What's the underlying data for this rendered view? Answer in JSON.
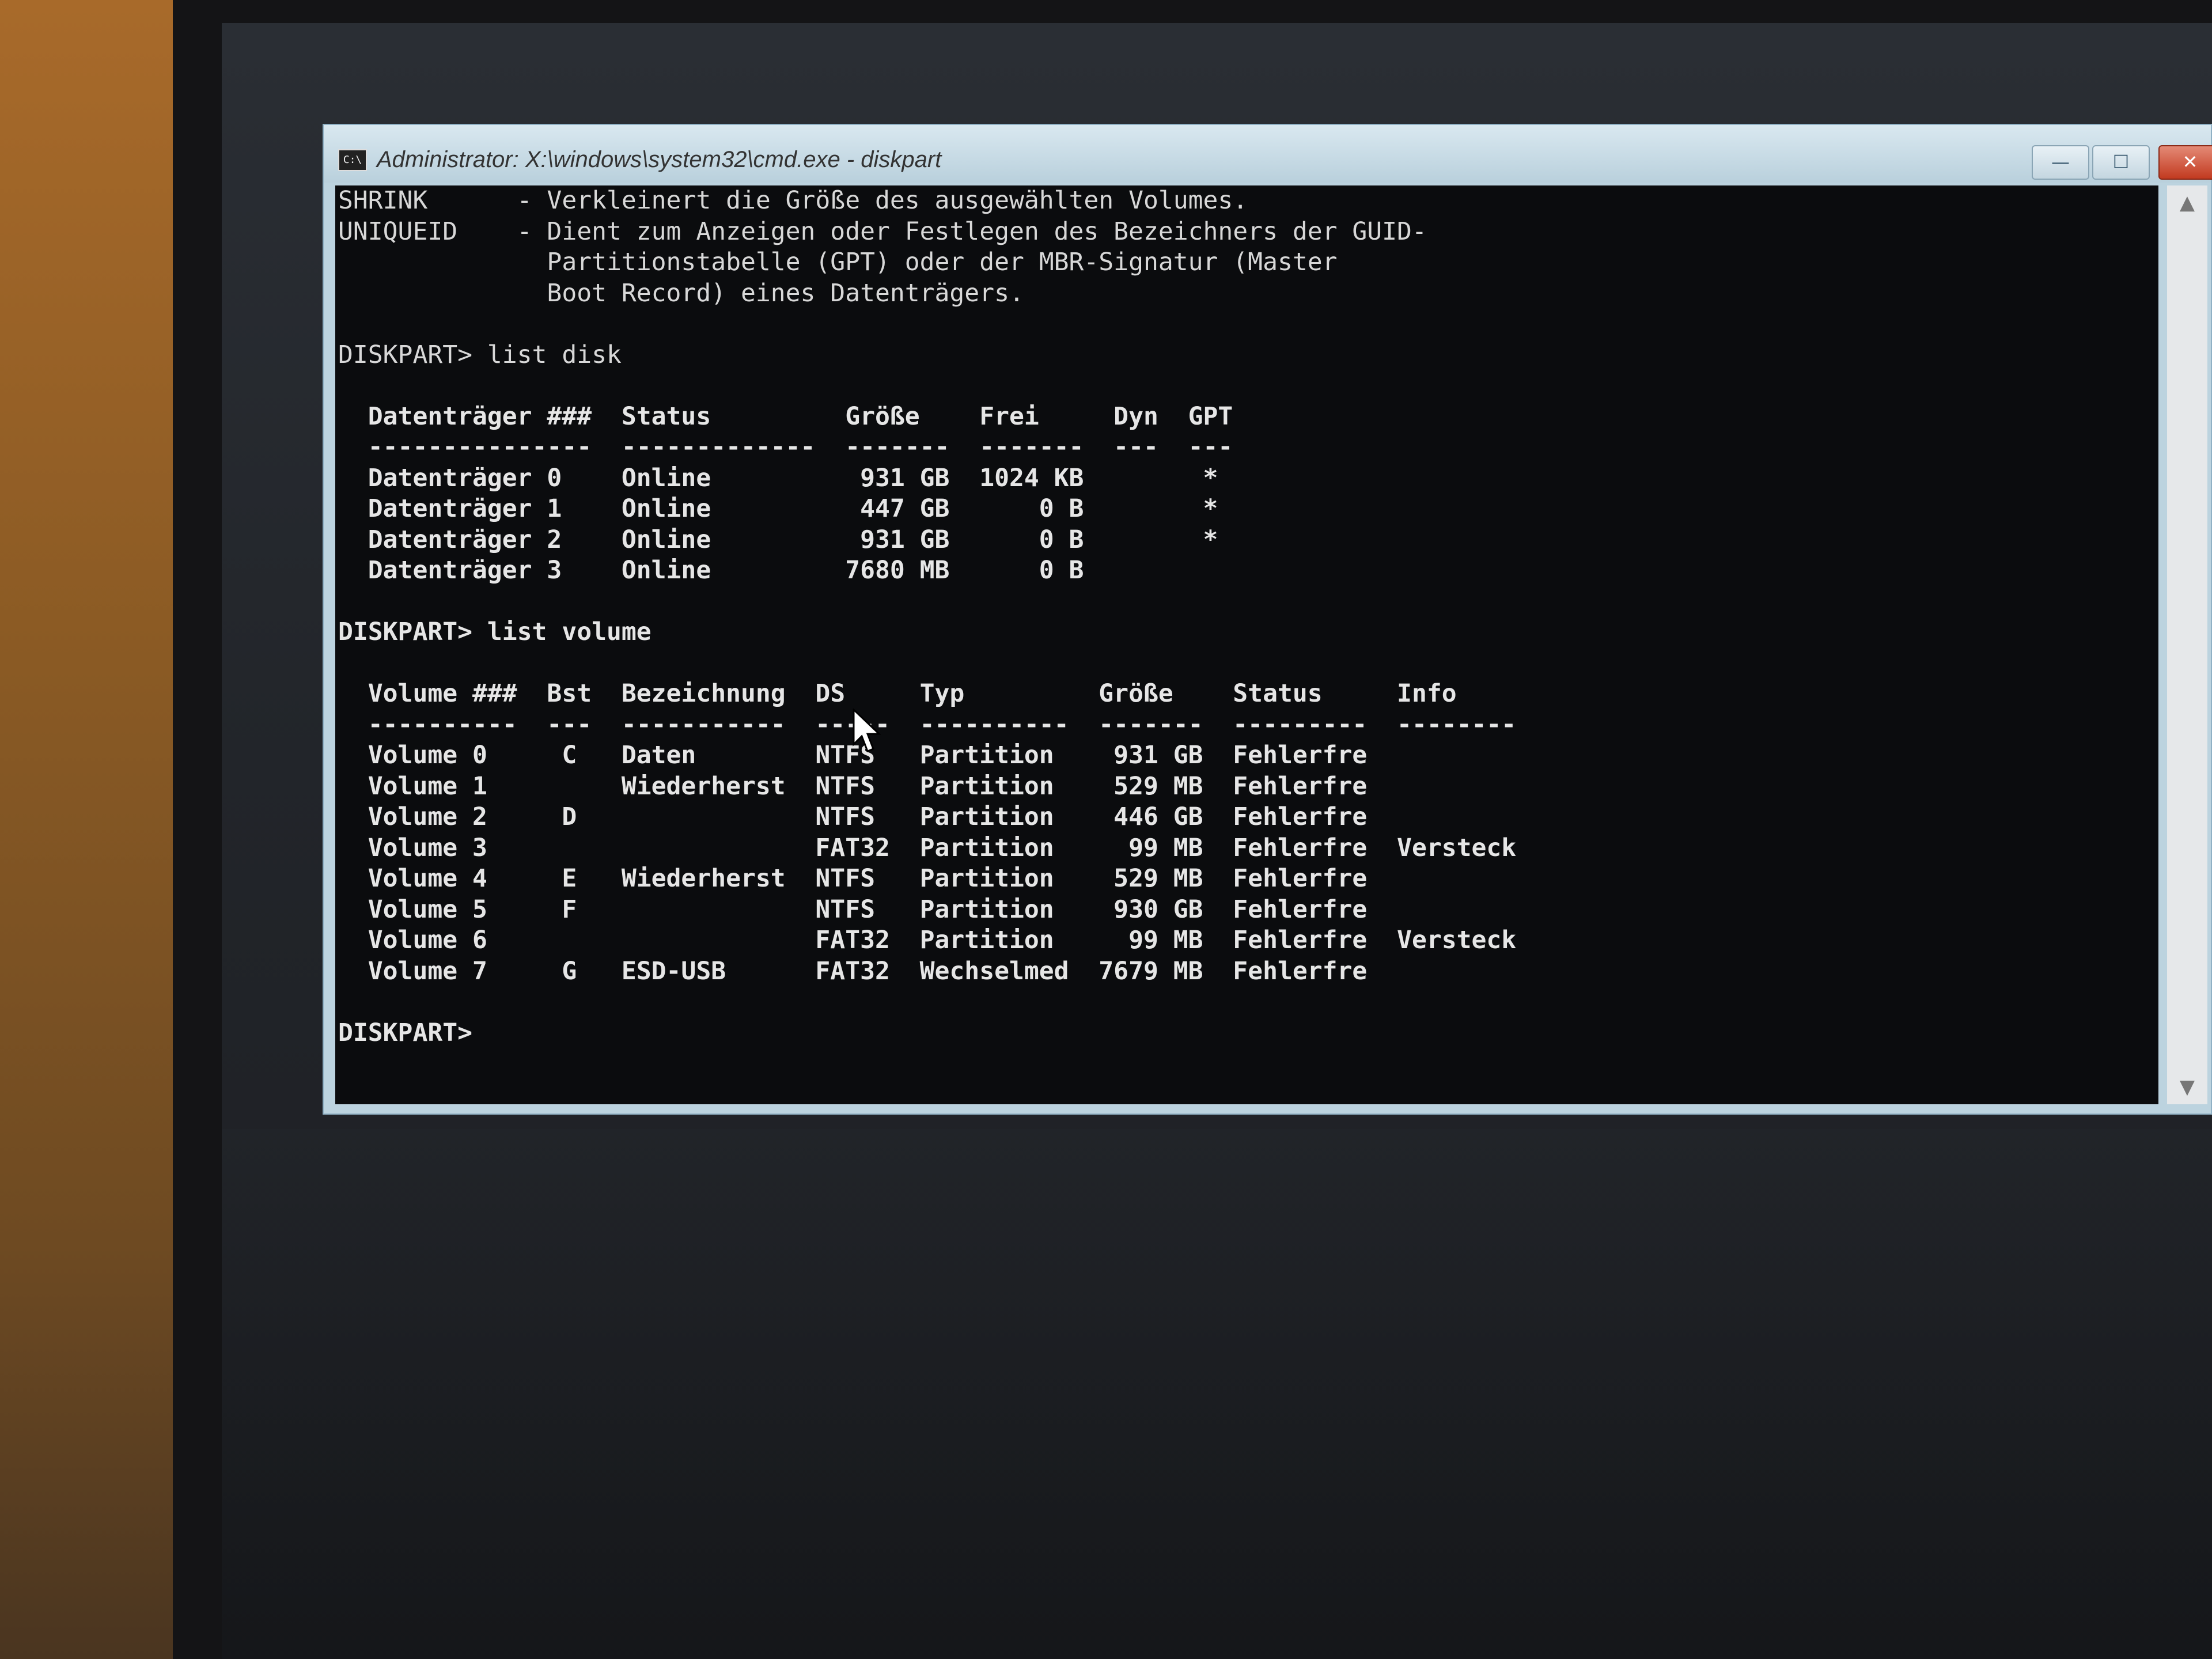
{
  "window": {
    "title": "Administrator: X:\\windows\\system32\\cmd.exe - diskpart",
    "icon_label": "C:\\",
    "buttons": {
      "minimize": "—",
      "maximize": "☐",
      "close": "✕"
    }
  },
  "console": {
    "help_lines": [
      "SHRINK      - Verkleinert die Größe des ausgewählten Volumes.",
      "UNIQUEID    - Dient zum Anzeigen oder Festlegen des Bezeichners der GUID-",
      "              Partitionstabelle (GPT) oder der MBR-Signatur (Master",
      "              Boot Record) eines Datenträgers."
    ],
    "cmd_list_disk": "DISKPART> list disk",
    "disk_table": [
      "  Datenträger ###  Status         Größe    Frei     Dyn  GPT",
      "  ---------------  -------------  -------  -------  ---  ---",
      "  Datenträger 0    Online          931 GB  1024 KB        *",
      "  Datenträger 1    Online          447 GB      0 B        *",
      "  Datenträger 2    Online          931 GB      0 B        *",
      "  Datenträger 3    Online         7680 MB      0 B"
    ],
    "cmd_list_volume": "DISKPART> list volume",
    "volume_table": [
      "  Volume ###  Bst  Bezeichnung  DS     Typ         Größe    Status     Info",
      "  ----------  ---  -----------  -----  ----------  -------  ---------  --------",
      "  Volume 0     C   Daten        NTFS   Partition    931 GB  Fehlerfre",
      "  Volume 1         Wiederherst  NTFS   Partition    529 MB  Fehlerfre",
      "  Volume 2     D                NTFS   Partition    446 GB  Fehlerfre",
      "  Volume 3                      FAT32  Partition     99 MB  Fehlerfre  Versteck",
      "  Volume 4     E   Wiederherst  NTFS   Partition    529 MB  Fehlerfre",
      "  Volume 5     F                NTFS   Partition    930 GB  Fehlerfre",
      "  Volume 6                      FAT32  Partition     99 MB  Fehlerfre  Versteck",
      "  Volume 7     G   ESD-USB      FAT32  Wechselmed  7679 MB  Fehlerfre"
    ],
    "prompt": "DISKPART>"
  },
  "scrollbar": {
    "up": "▲",
    "down": "▼"
  }
}
